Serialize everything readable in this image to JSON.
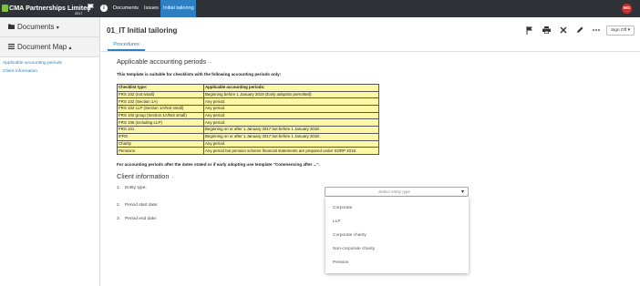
{
  "header": {
    "company": "CMA Partnerships Limited",
    "year": "2017",
    "info_glyph": "i",
    "nav": [
      "Documents",
      "Issues",
      "Initial tailoring"
    ],
    "active_tab": "Initial tailoring",
    "user_initials": "MS",
    "colors": {
      "bar": "#2f3338",
      "accent": "#2e7fc2",
      "avatar": "#c9302c",
      "logo": "#7cc242"
    }
  },
  "sidebar": {
    "documents": "Documents",
    "document_map": "Document Map",
    "links": [
      "Applicable accounting periods",
      "Client information"
    ]
  },
  "main": {
    "title": "01_IT Initial tailoring",
    "signoff": "Sign Off",
    "tab": "Procedures",
    "toolbar_icons": [
      "flag-icon",
      "print-icon",
      "cross-tools-icon",
      "pencil-icon",
      "more-icon"
    ]
  },
  "section1": {
    "heading": "Applicable accounting periods",
    "collapse": "–",
    "intro": "This template is suitable for checklists with the following accounting periods only:",
    "table_header": [
      "Checklist type:",
      "Applicable accounting periods:"
    ],
    "rows": [
      [
        "FRS 102 (not small)",
        "Beginning before 1 January 2019 (Early adoption permitted)."
      ],
      [
        "FRS 102 (Section 1A)",
        "Any period."
      ],
      [
        "FRS 102 LLP (Section 1A/Not small)",
        "Any period."
      ],
      [
        "FRS 102 group (Section 1A/Not small)",
        "Any period."
      ],
      [
        "FRS 105 (including LLP)",
        "Any period."
      ],
      [
        "FRS 101",
        "Beginning on or after 1 January 2017 but before 1 January 2018."
      ],
      [
        "IFRS",
        "Beginning on or after 1 January 2017 but before 1 January 2018."
      ],
      [
        "Charity",
        "Any period."
      ],
      [
        "Pensions",
        "Any period but pension scheme financial statements are prepared under SORP 2018."
      ]
    ],
    "table_color": "#fbf7a4",
    "note": "For accounting periods after the dates stated or if early adopting use template \"Commencing after ...\"."
  },
  "section2": {
    "heading": "Client information",
    "collapse": "–",
    "questions": [
      {
        "num": "1.",
        "label": "Entity type:"
      },
      {
        "num": "2.",
        "label": "Period start date:"
      },
      {
        "num": "3.",
        "label": "Period end date:"
      }
    ],
    "entity_select": {
      "placeholder": "Select entity type",
      "options": [
        "Corporate",
        "LLP",
        "Corporate charity",
        "Non-corporate charity",
        "Pension"
      ]
    }
  }
}
